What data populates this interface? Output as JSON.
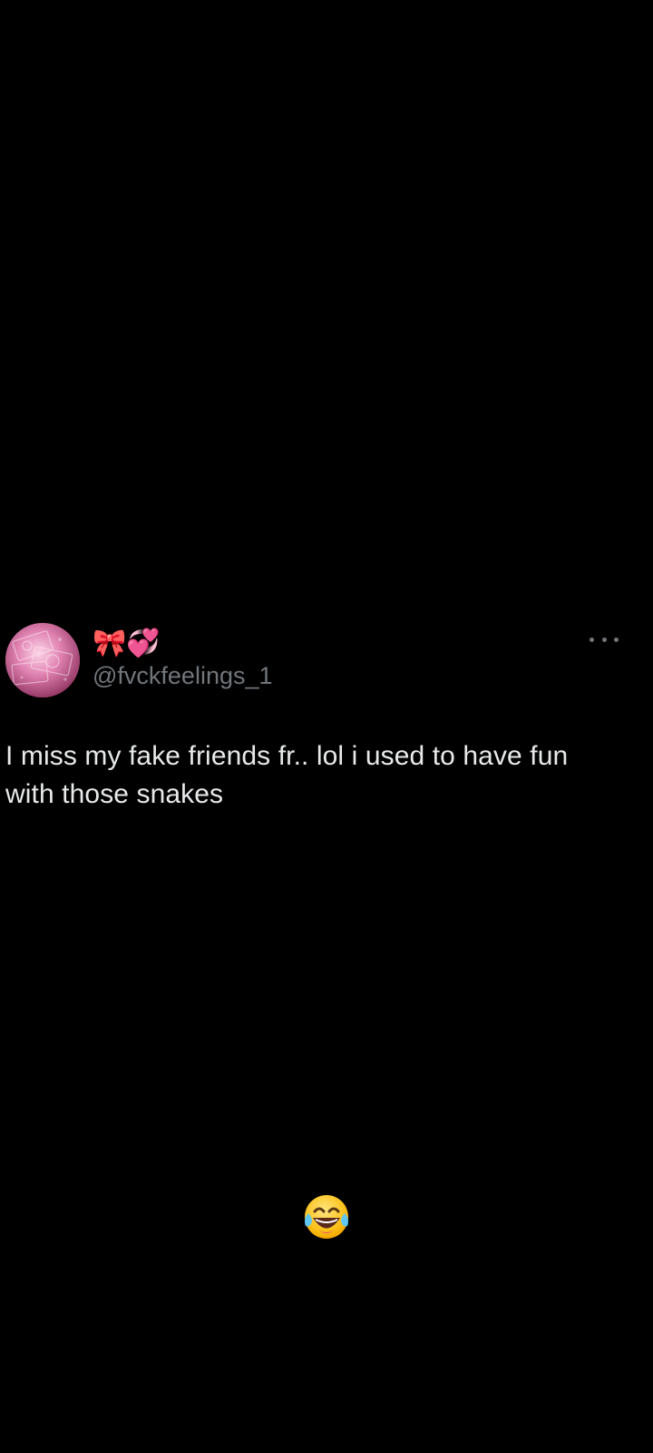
{
  "tweet": {
    "display_name": "🎀💞",
    "handle": "@fvckfeelings_1",
    "text": "I miss my fake friends fr.. lol i used to have fun with those snakes"
  },
  "more_button": {
    "icon": "more-dots-icon"
  },
  "sticker": {
    "icon": "face-with-tears-of-joy-emoji"
  },
  "colors": {
    "background": "#000000",
    "primary_text": "#e7e9ea",
    "secondary_text": "#71767b"
  }
}
